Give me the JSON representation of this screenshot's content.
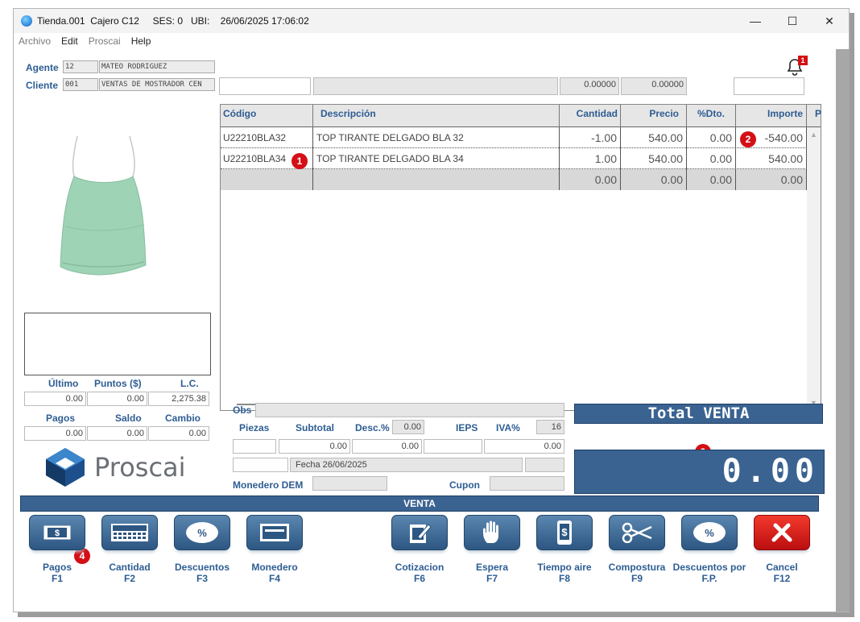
{
  "window": {
    "title": "Tienda.001  Cajero C12     SES: 0   UBI:    26/06/2025 17:06:02",
    "minimize": "—",
    "maximize": "☐",
    "close": "✕"
  },
  "menu": [
    "Archivo",
    "Edit",
    "Proscai",
    "Help"
  ],
  "agent": {
    "label": "Agente",
    "code": "12",
    "name": "MATEO RODRIGUEZ"
  },
  "client": {
    "label": "Cliente",
    "code": "001",
    "name": "VENTAS DE MOSTRADOR CEN"
  },
  "notifications": {
    "count": "1"
  },
  "top_inputs": {
    "v1": "",
    "v2": "",
    "v3": "0.00000",
    "v4": "0.00000",
    "v5": ""
  },
  "grid": {
    "columns": [
      "Código",
      "Descripción",
      "Cantidad",
      "Precio",
      "%Dto.",
      "Importe",
      "P"
    ],
    "rows": [
      {
        "codigo": "U22210BLA32",
        "descripcion": "TOP TIRANTE DELGADO BLA 32",
        "cantidad": "-1.00",
        "precio": "540.00",
        "dto": "0.00",
        "importe": "-540.00"
      },
      {
        "codigo": "U22210BLA34",
        "descripcion": "TOP TIRANTE DELGADO BLA 34",
        "cantidad": "1.00",
        "precio": "540.00",
        "dto": "0.00",
        "importe": "540.00"
      },
      {
        "codigo": "",
        "descripcion": "",
        "cantidad": "0.00",
        "precio": "0.00",
        "dto": "0.00",
        "importe": "0.00"
      }
    ]
  },
  "stats": {
    "ultimo_label": "Último",
    "puntos_label": "Puntos ($)",
    "lc_label": "L.C.",
    "ultimo": "0.00",
    "puntos": "0.00",
    "lc": "2,275.38",
    "pagos_label": "Pagos",
    "saldo_label": "Saldo",
    "cambio_label": "Cambio",
    "pagos": "0.00",
    "saldo": "0.00",
    "cambio": "0.00"
  },
  "brand": "Proscai",
  "summary": {
    "obs_label": "Obs",
    "piezas_label": "Piezas",
    "subtotal_label": "Subtotal",
    "desc_label": "Desc.%",
    "desc_value": "0.00",
    "ieps_label": "IEPS",
    "iva_label": "IVA%",
    "iva_value": "16",
    "piezas": "",
    "subtotal": "0.00",
    "descuento": "0.00",
    "ieps": "",
    "iva": "0.00",
    "fecha": "Fecha 26/06/2025",
    "monedero_label": "Monedero DEM",
    "cupon_label": "Cupon"
  },
  "total_label": "Total VENTA",
  "total_value": "0.00",
  "mode_label": "VENTA",
  "badges": [
    "1",
    "2",
    "3",
    "4"
  ],
  "fkeys": [
    {
      "label": "Pagos",
      "key": "F1",
      "icon": "cash-icon"
    },
    {
      "label": "Cantidad",
      "key": "F2",
      "icon": "calculator-icon"
    },
    {
      "label": "Descuentos",
      "key": "F3",
      "icon": "percent-icon"
    },
    {
      "label": "Monedero",
      "key": "F4",
      "icon": "wallet-card-icon"
    },
    {
      "label": "Cotizacion",
      "key": "F6",
      "icon": "quote-edit-icon"
    },
    {
      "label": "Espera",
      "key": "F7",
      "icon": "hand-stop-icon"
    },
    {
      "label": "Tiempo aire",
      "key": "F8",
      "icon": "phone-dollar-icon"
    },
    {
      "label": "Compostura",
      "key": "F9",
      "icon": "scissors-icon"
    },
    {
      "label": "Descuentos por F.P.",
      "label_line1": "Descuentos por",
      "label_line2": "F.P.",
      "key": "F.P.",
      "icon": "percent-icon"
    },
    {
      "label": "Cancel",
      "key": "F12",
      "icon": "cancel-x-icon"
    }
  ],
  "colors": {
    "accent": "#3a6391",
    "label_blue": "#2d5d93",
    "badge_red": "#d40f16",
    "cancel_red": "#d4211c"
  }
}
